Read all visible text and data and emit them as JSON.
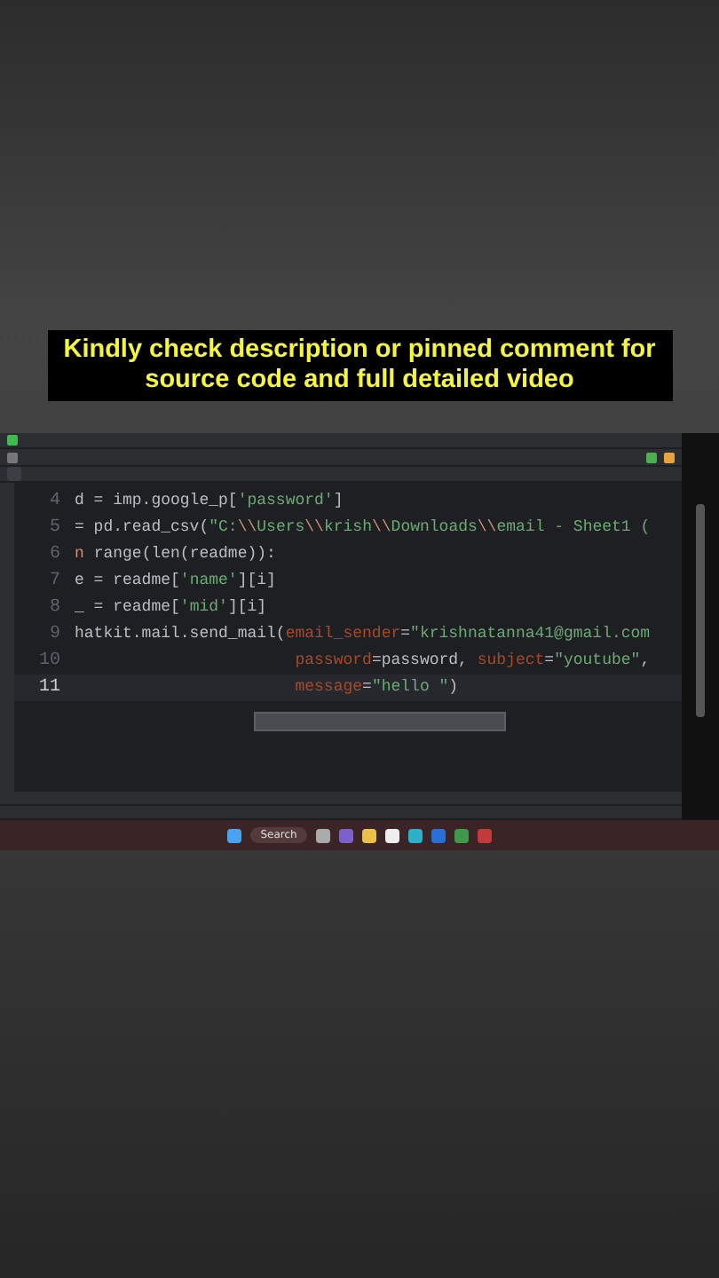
{
  "caption": "Kindly check description or pinned comment for source code and full detailed video",
  "editor": {
    "lines": [
      {
        "number": "4",
        "current": false,
        "tokens": [
          {
            "kind": "plain",
            "text": "d = imp.google_p["
          },
          {
            "kind": "string",
            "text": "'password'"
          },
          {
            "kind": "plain",
            "text": "]"
          }
        ]
      },
      {
        "number": "5",
        "current": false,
        "tokens": [
          {
            "kind": "plain",
            "text": "= pd.read_csv("
          },
          {
            "kind": "string",
            "text": "\"C:"
          },
          {
            "kind": "escape",
            "text": "\\\\"
          },
          {
            "kind": "string",
            "text": "Users"
          },
          {
            "kind": "escape",
            "text": "\\\\"
          },
          {
            "kind": "string",
            "text": "krish"
          },
          {
            "kind": "escape",
            "text": "\\\\"
          },
          {
            "kind": "string",
            "text": "Downloads"
          },
          {
            "kind": "escape",
            "text": "\\\\"
          },
          {
            "kind": "string",
            "text": "email - Sheet1 ("
          }
        ]
      },
      {
        "number": "6",
        "current": false,
        "tokens": [
          {
            "kind": "keyword",
            "text": "n "
          },
          {
            "kind": "plain",
            "text": "range(len(readme)):"
          }
        ]
      },
      {
        "number": "7",
        "current": false,
        "tokens": [
          {
            "kind": "plain",
            "text": "e = readme["
          },
          {
            "kind": "string",
            "text": "'name'"
          },
          {
            "kind": "plain",
            "text": "][i]"
          }
        ]
      },
      {
        "number": "8",
        "current": false,
        "tokens": [
          {
            "kind": "plain",
            "text": "_ = readme["
          },
          {
            "kind": "string",
            "text": "'mid'"
          },
          {
            "kind": "plain",
            "text": "][i]"
          }
        ]
      },
      {
        "number": "9",
        "current": false,
        "tokens": [
          {
            "kind": "plain",
            "text": "hatkit.mail.send_mail("
          },
          {
            "kind": "param",
            "text": "email_sender"
          },
          {
            "kind": "plain",
            "text": "="
          },
          {
            "kind": "string",
            "text": "\"krishnatanna41@gmail.com"
          }
        ]
      },
      {
        "number": "10",
        "current": false,
        "indent": true,
        "tokens": [
          {
            "kind": "param",
            "text": "password"
          },
          {
            "kind": "plain",
            "text": "=password, "
          },
          {
            "kind": "param",
            "text": "subject"
          },
          {
            "kind": "plain",
            "text": "="
          },
          {
            "kind": "string",
            "text": "\"youtube\""
          },
          {
            "kind": "plain",
            "text": ","
          }
        ]
      },
      {
        "number": "11",
        "current": true,
        "indent": true,
        "tokens": [
          {
            "kind": "param",
            "text": "message"
          },
          {
            "kind": "plain",
            "text": "="
          },
          {
            "kind": "string",
            "text": "\"hello \""
          },
          {
            "kind": "plain",
            "text": ")"
          }
        ]
      }
    ]
  },
  "taskbar": {
    "search": "Search"
  }
}
